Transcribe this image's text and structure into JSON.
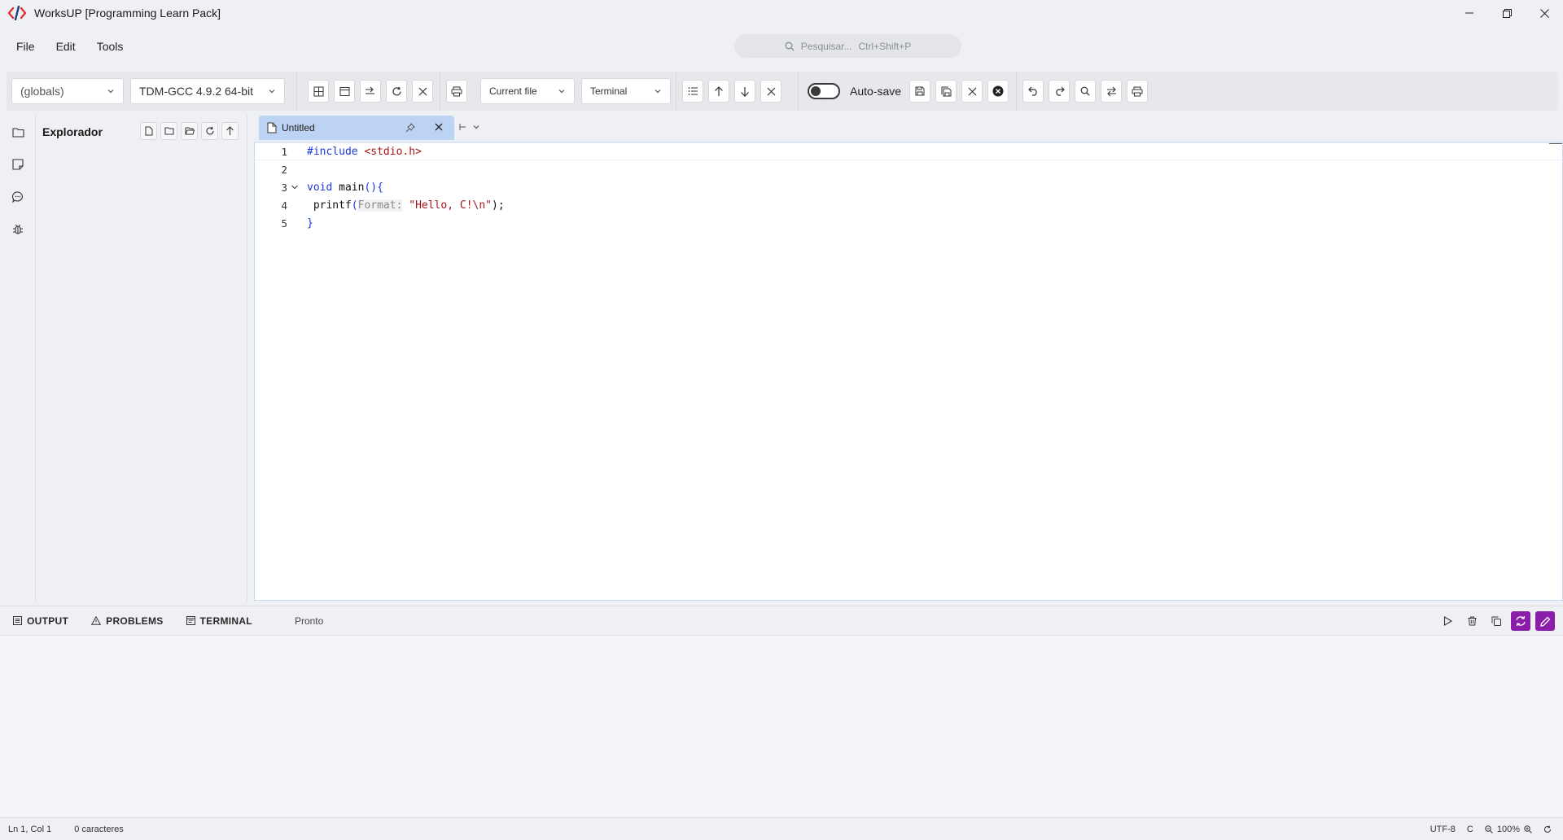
{
  "window": {
    "title": "WorksUP [Programming Learn Pack]",
    "accent_color": "#e03131"
  },
  "menu": {
    "items": [
      "File",
      "Edit",
      "Tools"
    ]
  },
  "search": {
    "placeholder": "Pesquisar...",
    "shortcut": "Ctrl+Shift+P"
  },
  "toolbar": {
    "scope_select": "(globals)",
    "compiler_select": "TDM-GCC 4.9.2 64-bit",
    "run_target_select": "Current file",
    "output_select": "Terminal",
    "autosave_label": "Auto-save",
    "autosave_on": false
  },
  "explorer": {
    "title": "Explorador"
  },
  "editor": {
    "tab_title": "Untitled",
    "lines": [
      {
        "n": "1",
        "tokens": [
          {
            "t": "#include ",
            "c": "inc"
          },
          {
            "t": "<stdio.h>",
            "c": "str"
          }
        ]
      },
      {
        "n": "2",
        "tokens": []
      },
      {
        "n": "3",
        "tokens": [
          {
            "t": "void",
            "c": "kw"
          },
          {
            "t": " main",
            "c": "fn"
          },
          {
            "t": "(){",
            "c": "brace"
          }
        ]
      },
      {
        "n": "4",
        "tokens": [
          {
            "t": " printf",
            "c": "fn"
          },
          {
            "t": "(",
            "c": "brace"
          },
          {
            "t": "Format:",
            "c": "hint"
          },
          {
            "t": " ",
            "c": "fn"
          },
          {
            "t": "\"Hello, C!\\n\"",
            "c": "str"
          },
          {
            "t": ");",
            "c": "fn"
          }
        ]
      },
      {
        "n": "5",
        "tokens": [
          {
            "t": "}",
            "c": "brace"
          }
        ]
      }
    ]
  },
  "panel": {
    "tabs": [
      "OUTPUT",
      "PROBLEMS",
      "TERMINAL"
    ],
    "status": "Pronto",
    "action_color": "#8a1ea8"
  },
  "statusbar": {
    "position": "Ln 1, Col 1",
    "chars": "0 caracteres",
    "encoding": "UTF-8",
    "language": "C",
    "zoom": "100%"
  }
}
